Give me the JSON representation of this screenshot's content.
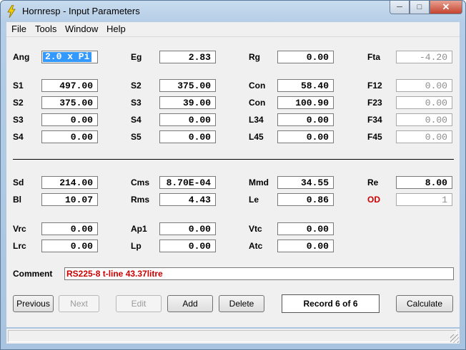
{
  "window": {
    "title": "Hornresp - Input Parameters"
  },
  "menu": [
    "File",
    "Tools",
    "Window",
    "Help"
  ],
  "params": {
    "Ang": "2.0 x Pi",
    "Eg": "2.83",
    "Rg": "0.00",
    "Fta": "-4.20",
    "S1": "497.00",
    "S2a": "375.00",
    "Con1": "58.40",
    "F12": "0.00",
    "S2": "375.00",
    "S3a": "39.00",
    "Con2": "100.90",
    "F23": "0.00",
    "S3": "0.00",
    "S4a": "0.00",
    "L34": "0.00",
    "F34": "0.00",
    "S4": "0.00",
    "S5": "0.00",
    "L45": "0.00",
    "F45": "0.00",
    "Sd": "214.00",
    "Cms": "8.70E-04",
    "Mmd": "34.55",
    "Re": "8.00",
    "Bl": "10.07",
    "Rms": "4.43",
    "Le": "0.86",
    "OD": "1",
    "Vrc": "0.00",
    "Ap1": "0.00",
    "Vtc": "0.00",
    "Lrc": "0.00",
    "Lp": "0.00",
    "Atc": "0.00"
  },
  "labels": {
    "Ang": "Ang",
    "Eg": "Eg",
    "Rg": "Rg",
    "Fta": "Fta",
    "S1": "S1",
    "S2a": "S2",
    "Con1": "Con",
    "F12": "F12",
    "S2": "S2",
    "S3a": "S3",
    "Con2": "Con",
    "F23": "F23",
    "S3": "S3",
    "S4a": "S4",
    "L34": "L34",
    "F34": "F34",
    "S4": "S4",
    "S5": "S5",
    "L45": "L45",
    "F45": "F45",
    "Sd": "Sd",
    "Cms": "Cms",
    "Mmd": "Mmd",
    "Re": "Re",
    "Bl": "Bl",
    "Rms": "Rms",
    "Le": "Le",
    "OD": "OD",
    "Vrc": "Vrc",
    "Ap1": "Ap1",
    "Vtc": "Vtc",
    "Lrc": "Lrc",
    "Lp": "Lp",
    "Atc": "Atc",
    "Comment": "Comment"
  },
  "comment": "RS225-8 t-line 43.37litre",
  "buttons": {
    "previous": "Previous",
    "next": "Next",
    "edit": "Edit",
    "add": "Add",
    "delete": "Delete",
    "calculate": "Calculate"
  },
  "record": "Record 6 of 6",
  "colors": {
    "accent": "#3399ff",
    "red_label": "#cc0000"
  },
  "icons": {
    "app": "lightning-icon",
    "minimize": "minimize-icon",
    "maximize": "maximize-icon",
    "close": "close-icon"
  }
}
